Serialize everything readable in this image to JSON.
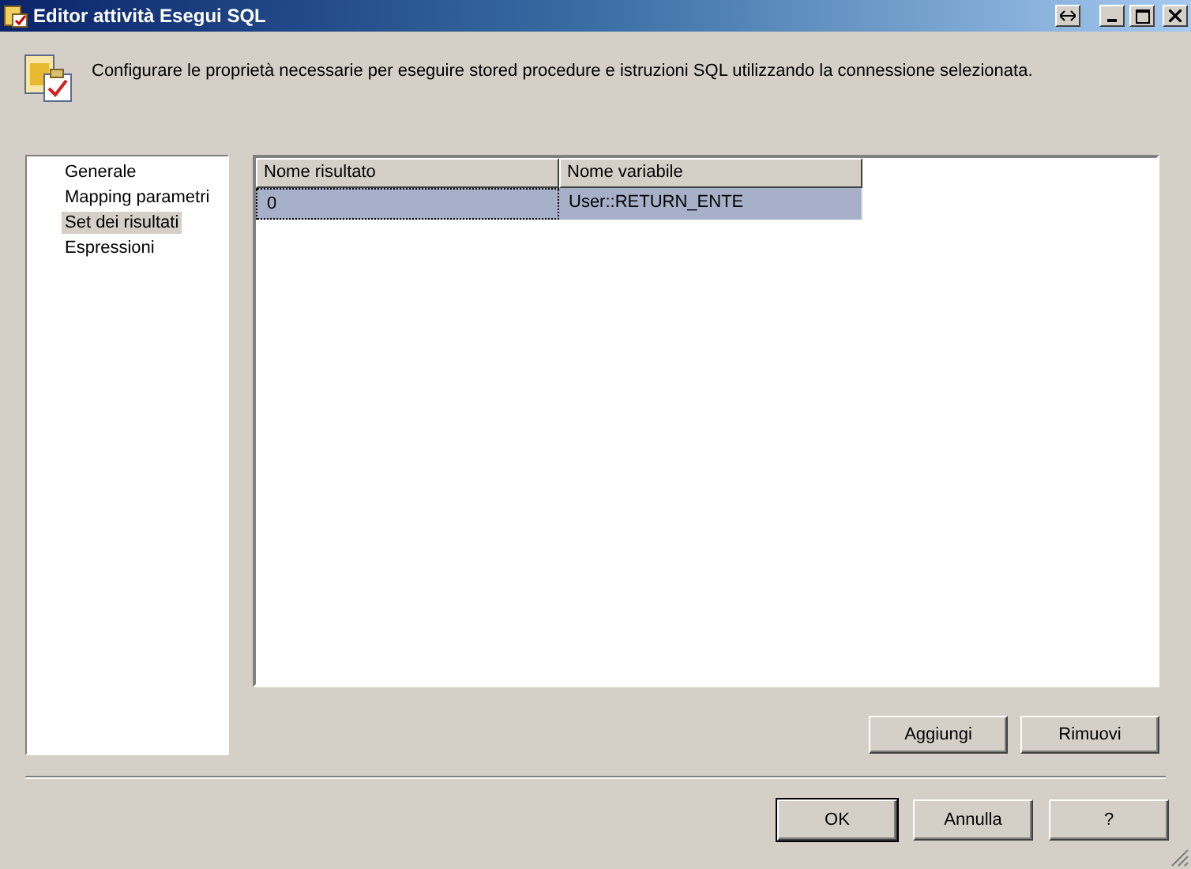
{
  "window": {
    "title": "Editor attività Esegui SQL"
  },
  "description": "Configurare le proprietà necessarie per eseguire stored procedure e istruzioni SQL utilizzando la connessione selezionata.",
  "sidebar": {
    "items": [
      {
        "label": "Generale",
        "selected": false
      },
      {
        "label": "Mapping parametri",
        "selected": false
      },
      {
        "label": "Set dei risultati",
        "selected": true
      },
      {
        "label": "Espressioni",
        "selected": false
      }
    ]
  },
  "table": {
    "columns": [
      "Nome risultato",
      "Nome variabile"
    ],
    "rows": [
      {
        "cells": [
          "0",
          "User::RETURN_ENTE"
        ],
        "selected": true
      }
    ]
  },
  "table_buttons": [
    "Aggiungi",
    "Rimuovi"
  ],
  "dialog_buttons": [
    {
      "label": "OK",
      "default": true
    },
    {
      "label": "Annulla",
      "default": false
    },
    {
      "label": "?",
      "default": false
    }
  ]
}
